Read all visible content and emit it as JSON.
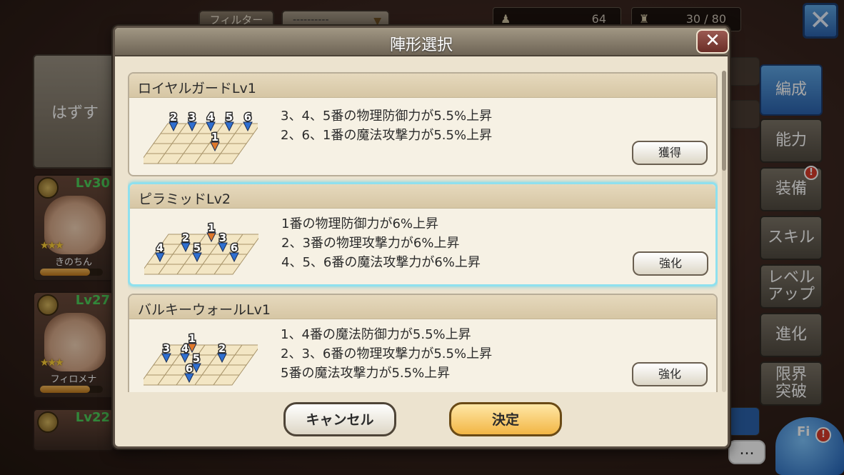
{
  "top_bar": {
    "filter_label": "フィルター",
    "filter_value": "----------",
    "stamina": "64",
    "capacity": "30 / 80"
  },
  "left": {
    "remove_label": "はずす",
    "characters": [
      {
        "level": "Lv30",
        "stars": "★★★",
        "name": "きのちん"
      },
      {
        "level": "Lv27",
        "stars": "★★★",
        "name": "フィロメナ"
      },
      {
        "level": "Lv22",
        "stars": "",
        "name": ""
      }
    ]
  },
  "side_tabs": {
    "formation": "編成",
    "ability": "能力",
    "equip": "装備",
    "equip_badge": "!",
    "skill": "スキル",
    "level_up_1": "レベル",
    "level_up_2": "アップ",
    "evolve": "進化",
    "limit_1": "限界",
    "limit_2": "突破"
  },
  "chat": {
    "label": "..."
  },
  "mascot": {
    "label": "Fi",
    "badge": "!"
  },
  "dialog": {
    "title": "陣形選択",
    "close": "✕",
    "formations": [
      {
        "name": "ロイヤルガードLv1",
        "effects": [
          "3、4、5番の物理防御力が5.5%上昇",
          "2、6、1番の魔法攻撃力が5.5%上昇"
        ],
        "action": "獲得",
        "selected": false,
        "slots": [
          "2",
          "3",
          "4",
          "5",
          "6",
          "1"
        ]
      },
      {
        "name": "ピラミッドLv2",
        "effects": [
          "1番の物理防御力が6%上昇",
          "2、3番の物理攻撃力が6%上昇",
          "4、5、6番の魔法攻撃力が6%上昇"
        ],
        "action": "強化",
        "selected": true,
        "slots": [
          "4",
          "2",
          "1",
          "5",
          "3",
          "6"
        ]
      },
      {
        "name": "バルキーウォールLv1",
        "effects": [
          "1、4番の魔法防御力が5.5%上昇",
          "2、3、6番の物理攻撃力が5.5%上昇",
          "5番の魔法攻撃力が5.5%上昇"
        ],
        "action": "強化",
        "selected": false,
        "slots": [
          "3",
          "1",
          "4",
          "5",
          "2",
          "6"
        ]
      }
    ],
    "cancel": "キャンセル",
    "confirm": "決定"
  },
  "colors": {
    "accent_blue": "#2c63ad",
    "highlight": "#8fe0ee",
    "marker_blue": "#2f6fd0",
    "marker_orange": "#e0782a",
    "confirm_gold": "#f2b645"
  }
}
